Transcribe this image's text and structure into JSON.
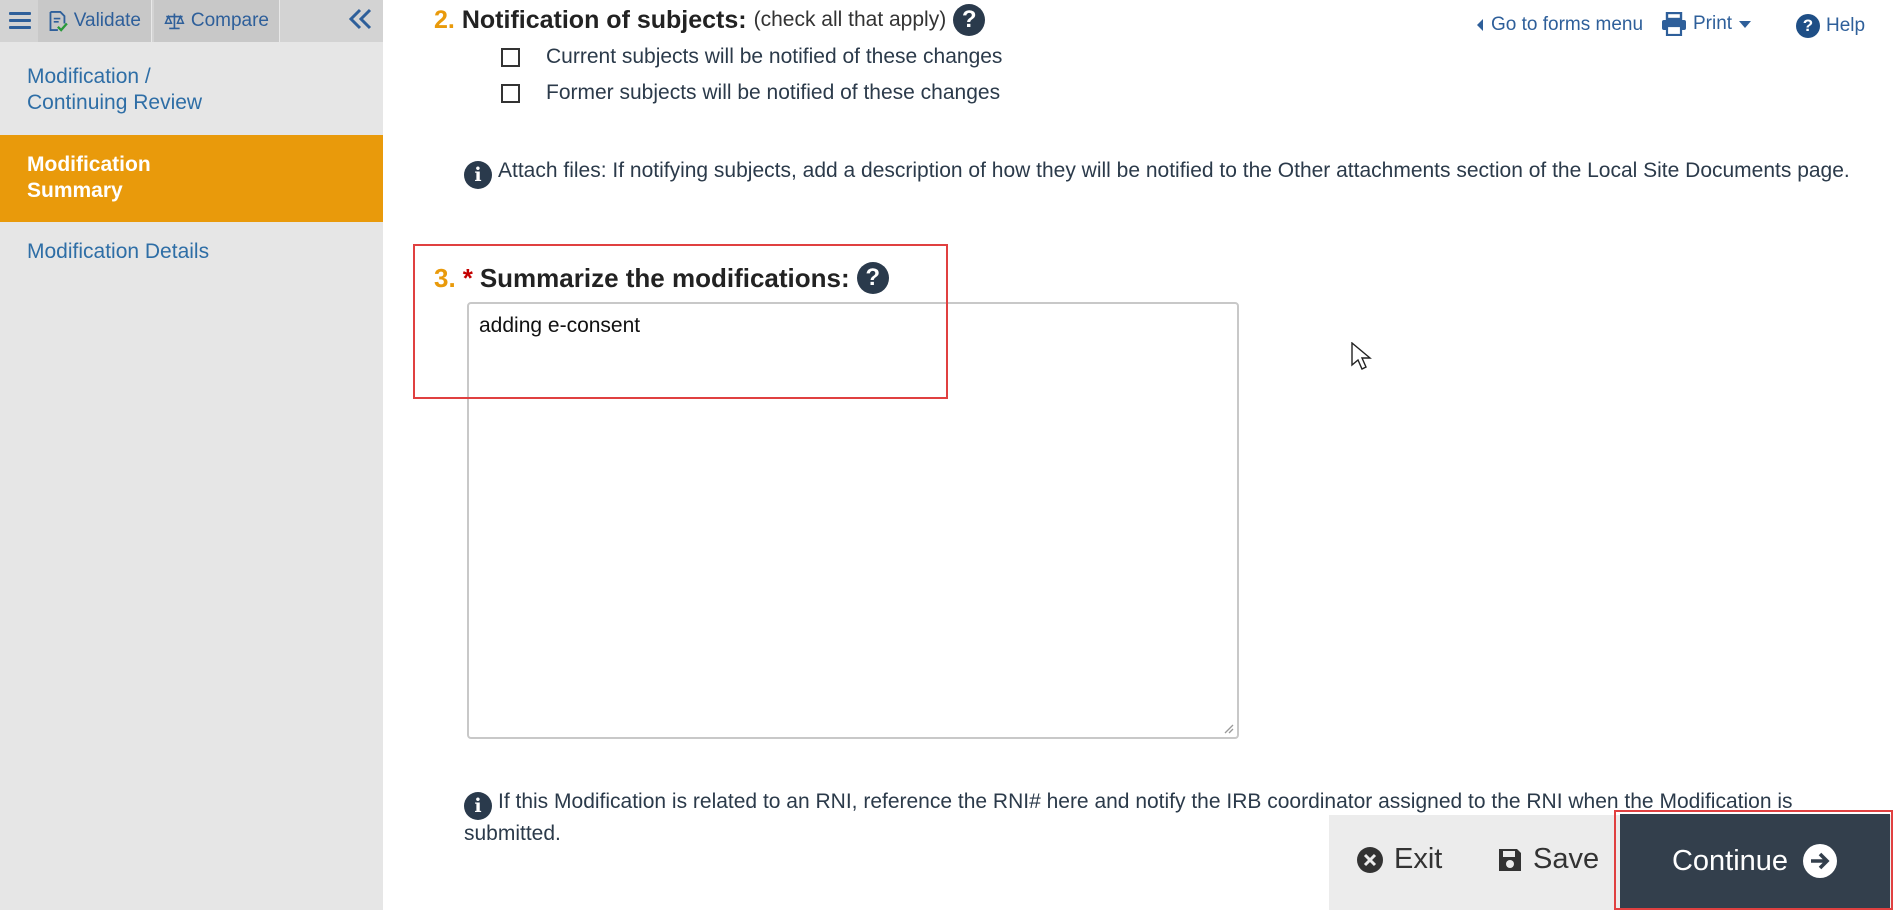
{
  "toolbar": {
    "validate": "Validate",
    "compare": "Compare"
  },
  "sidebar": {
    "items": [
      {
        "line1": "Modification /",
        "line2": "Continuing Review",
        "active": false
      },
      {
        "line1": "Modification",
        "line2": "Summary",
        "active": true
      },
      {
        "line1": "Modification Details",
        "line2": "",
        "active": false
      }
    ]
  },
  "top_links": {
    "forms_menu": "Go to forms menu",
    "print": "Print",
    "help": "Help"
  },
  "question2": {
    "number": "2.",
    "title": "Notification of subjects:",
    "hint": "(check all that apply)",
    "options": [
      {
        "label": "Current subjects will be notified of these changes",
        "checked": false
      },
      {
        "label": "Former subjects will be notified of these changes",
        "checked": false
      }
    ],
    "note": "Attach files: If notifying subjects, add a description of how they will be notified to the Other attachments section of the Local Site Documents page."
  },
  "question3": {
    "number": "3.",
    "required_mark": "*",
    "title": "Summarize the modifications:",
    "value": "adding e-consent"
  },
  "rni_note": "If this Modification is related to an RNI, reference the RNI# here and notify the IRB coordinator assigned to the RNI when the Modification is submitted.",
  "actions": {
    "exit": "Exit",
    "save": "Save",
    "continue": "Continue"
  },
  "colors": {
    "accent": "#e99a0b",
    "link": "#2e6ea6",
    "dark": "#333f4c",
    "highlight_box": "#e04040"
  }
}
